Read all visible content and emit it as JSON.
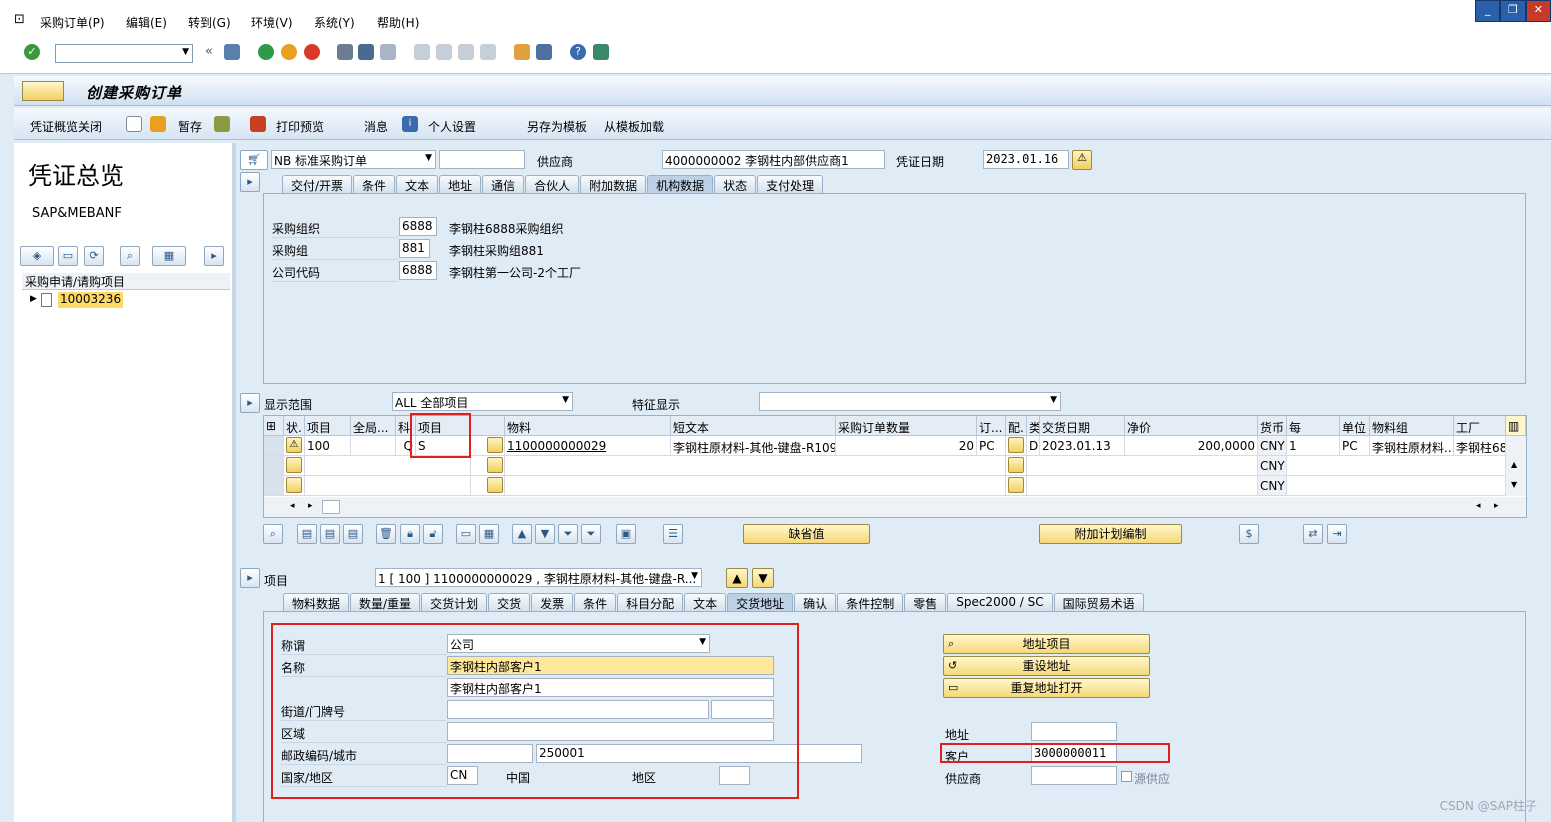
{
  "menu": {
    "items": [
      "采购订单(P)",
      "编辑(E)",
      "转到(G)",
      "环境(V)",
      "系统(Y)",
      "帮助(H)"
    ]
  },
  "window": {
    "min": "_",
    "restore": "❐",
    "close": "✕"
  },
  "title": "创建采购订单",
  "app_toolbar": {
    "overview_close": "凭证概览关闭",
    "hold": "暂存",
    "print_preview": "打印预览",
    "messages": "消息",
    "personal_settings": "个人设置",
    "save_as_template": "另存为模板",
    "load_from_template": "从模板加载"
  },
  "left_panel": {
    "title": "凭证总览",
    "subtitle": "SAP&MEBANF",
    "tree_header": "采购申请/请购项目",
    "tree_item": "10003236"
  },
  "header": {
    "doc_type": "NB 标准采购订单",
    "vendor_label": "供应商",
    "vendor_value": "4000000002 李钢柱内部供应商1",
    "doc_date_label": "凭证日期",
    "doc_date_value": "2023.01.16",
    "tabs": [
      "交付/开票",
      "条件",
      "文本",
      "地址",
      "通信",
      "合伙人",
      "附加数据",
      "机构数据",
      "状态",
      "支付处理"
    ],
    "active_tab": 7,
    "org": {
      "purch_org_label": "采购组织",
      "purch_org_value": "6888",
      "purch_org_text": "李钢柱6888采购组织",
      "purch_group_label": "采购组",
      "purch_group_value": "881",
      "purch_group_text": "李钢柱采购组881",
      "company_label": "公司代码",
      "company_value": "6888",
      "company_text": "李钢柱第一公司-2个工厂"
    }
  },
  "items_overview": {
    "scope_label": "显示范围",
    "scope_value": "ALL 全部项目",
    "feature_label": "特征显示",
    "feature_value": "",
    "columns": [
      "状.",
      "项目",
      "全局...",
      "科",
      "项目",
      "",
      "物料",
      "短文本",
      "采购订单数量",
      "订...",
      "配.",
      "类",
      "交货日期",
      "净价",
      "货币",
      "每",
      "单位",
      "物料组",
      "工厂"
    ],
    "row1": {
      "item": "100",
      "acct": "Q",
      "item_cat": "S",
      "material": "1100000000029",
      "short_text": "李钢柱原材料-其他-键盘-R109",
      "qty": "20",
      "unit": "PC",
      "cat": "D",
      "delivery_date": "2023.01.13",
      "net_price": "200,0000",
      "currency": "CNY",
      "per": "1",
      "order_unit": "PC",
      "mat_group": "李钢柱原材料...",
      "plant": "李钢柱68"
    },
    "row2_currency": "CNY",
    "row3_currency": "CNY",
    "btn_default": "缺省值",
    "btn_addplan": "附加计划编制"
  },
  "item_detail": {
    "item_label": "项目",
    "item_value": "1 [ 100 ] 1100000000029 , 李钢柱原材料-其他-键盘-R...",
    "tabs": [
      "物料数据",
      "数量/重量",
      "交货计划",
      "交货",
      "发票",
      "条件",
      "科目分配",
      "文本",
      "交货地址",
      "确认",
      "条件控制",
      "零售",
      "Spec2000 / SC",
      "国际贸易术语"
    ],
    "active_tab": 8,
    "address": {
      "title_label": "称谓",
      "title_value": "公司",
      "name_label": "名称",
      "name1": "李钢柱内部客户1",
      "name2": "李钢柱内部客户1",
      "street_label": "街道/门牌号",
      "street": "",
      "house": "",
      "district_label": "区域",
      "district": "",
      "postal_label": "邮政编码/城市",
      "postal": "",
      "city": "250001",
      "country_label": "国家/地区",
      "country": "CN",
      "country_text": "中国",
      "region_label": "地区",
      "region": ""
    },
    "buttons": {
      "addr_items": "地址项目",
      "reset_addr": "重设地址",
      "reopen_addr": "重复地址打开"
    },
    "right": {
      "address_label": "地址",
      "address_value": "",
      "customer_label": "客户",
      "customer_value": "3000000011",
      "vendor_label": "供应商",
      "vendor_value": "",
      "source_vendor_label": "源供应"
    }
  },
  "watermark": "CSDN @SAP柱子"
}
